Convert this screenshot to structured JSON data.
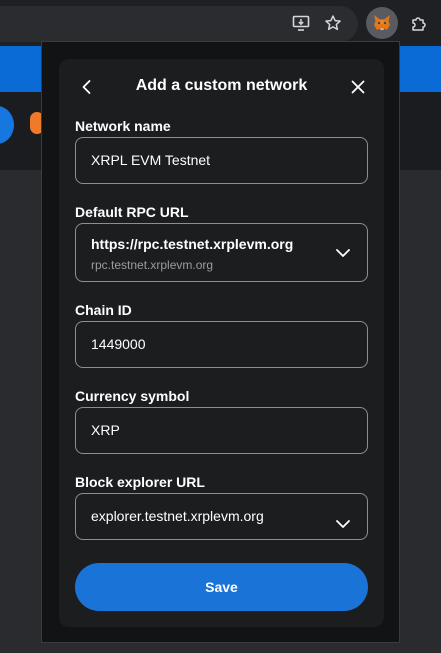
{
  "dialog": {
    "title": "Add a custom network",
    "fields": {
      "network_name": {
        "label": "Network name",
        "value": "XRPL EVM Testnet"
      },
      "rpc_url": {
        "label": "Default RPC URL",
        "value": "https://rpc.testnet.xrplevm.org",
        "sub_value": "rpc.testnet.xrplevm.org"
      },
      "chain_id": {
        "label": "Chain ID",
        "value": "1449000"
      },
      "currency_symbol": {
        "label": "Currency symbol",
        "value": "XRP"
      },
      "block_explorer": {
        "label": "Block explorer URL",
        "value": "explorer.testnet.xrplevm.org"
      }
    },
    "save_label": "Save"
  },
  "icons": [
    "install-app-icon",
    "star-icon",
    "metamask-fox-icon",
    "extensions-puzzle-icon",
    "back-arrow-icon",
    "close-icon",
    "chevron-down-icon"
  ],
  "colors": {
    "accent": "#1a73d6",
    "dialog_bg": "#1c1d1f",
    "border": "#8c8e94"
  }
}
